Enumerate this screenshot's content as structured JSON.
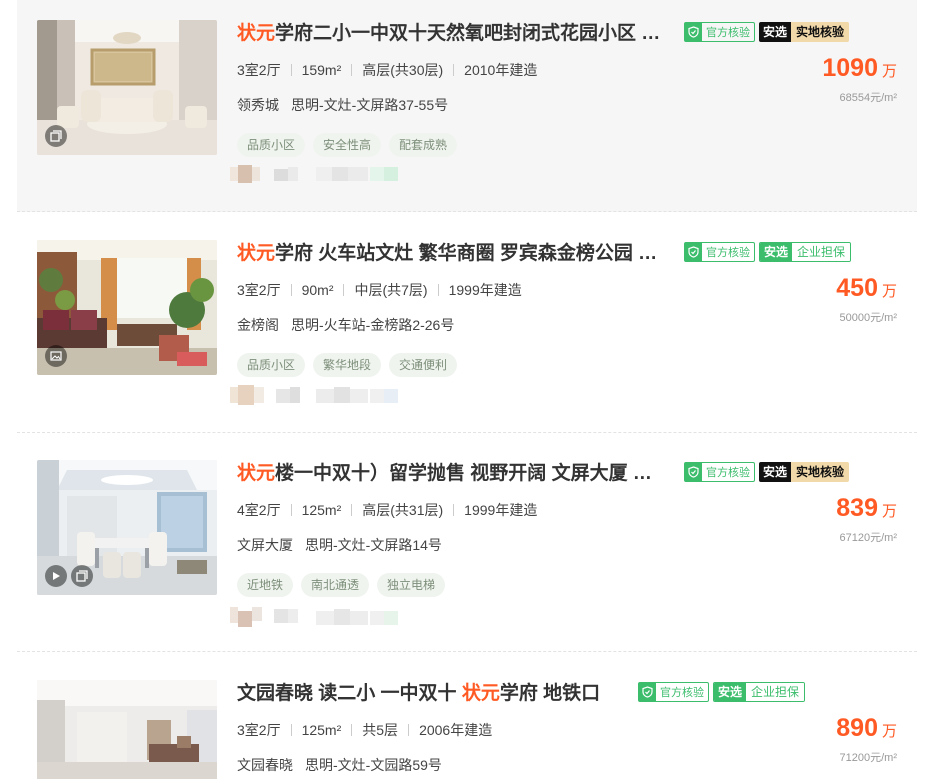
{
  "listings": [
    {
      "title_keyword": "状元",
      "title_rest": "学府二小一中双十天然氧吧封闭式花园小区 业主诚心出售",
      "badges": {
        "official": "官方核验",
        "anxuan": "安选",
        "verify": "实地核验"
      },
      "layout": "3室2厅",
      "area": "159m²",
      "floor": "高层(共30层)",
      "year": "2010年建造",
      "community": "领秀城",
      "district": "思明-文灶-文屏路37-55号",
      "tags": [
        "品质小区",
        "安全性高",
        "配套成熟"
      ],
      "price": "1090",
      "price_unit": "万",
      "unit_price": "68554元/m²",
      "thumb_icon": "album-icon"
    },
    {
      "title_keyword": "状元",
      "title_rest": "学府 火车站文灶 繁华商圈 罗宾森金榜公园 业主自住",
      "badges": {
        "official": "官方核验",
        "anxuan": "安选",
        "verify": "企业担保"
      },
      "layout": "3室2厅",
      "area": "90m²",
      "floor": "中层(共7层)",
      "year": "1999年建造",
      "community": "金榜阁",
      "district": "思明-火车站-金榜路2-26号",
      "tags": [
        "品质小区",
        "繁华地段",
        "交通便利"
      ],
      "price": "450",
      "price_unit": "万",
      "unit_price": "50000元/m²",
      "thumb_icon": "image-icon"
    },
    {
      "title_keyword": "状元",
      "title_rest": "楼一中双十）留学抛售 视野开阔 文屏大厦 精装修",
      "badges": {
        "official": "官方核验",
        "anxuan": "安选",
        "verify": "实地核验"
      },
      "layout": "4室2厅",
      "area": "125m²",
      "floor": "高层(共31层)",
      "year": "1999年建造",
      "community": "文屏大厦",
      "district": "思明-文灶-文屏路14号",
      "tags": [
        "近地铁",
        "南北通透",
        "独立电梯"
      ],
      "price": "839",
      "price_unit": "万",
      "unit_price": "67120元/m²",
      "thumb_icon": "video-icon"
    },
    {
      "title_pre": "文园春晓 读二小 一中双十 ",
      "title_keyword": "状元",
      "title_rest": "学府 地铁口",
      "badges": {
        "official": "官方核验",
        "anxuan": "安选",
        "verify": "企业担保"
      },
      "layout": "3室2厅",
      "area": "125m²",
      "floor": "共5层",
      "year": "2006年建造",
      "community": "文园春晓",
      "district": "思明-文灶-文园路59号",
      "price": "890",
      "price_unit": "万",
      "unit_price": "71200元/m²"
    }
  ],
  "colors": {
    "accent": "#ff5a24",
    "green": "#3bbd6c",
    "gold": "#f1d9aa"
  }
}
